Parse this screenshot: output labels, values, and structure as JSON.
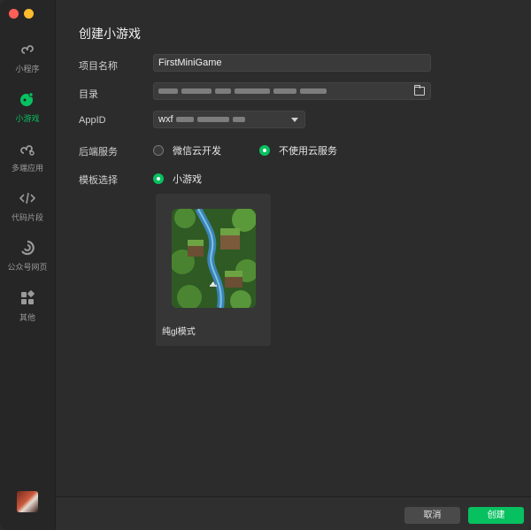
{
  "sidebar": {
    "items": [
      {
        "label": "小程序",
        "icon": "mini-program-icon"
      },
      {
        "label": "小游戏",
        "icon": "mini-game-icon",
        "active": true
      },
      {
        "label": "多端应用",
        "icon": "multi-platform-icon"
      },
      {
        "label": "代码片段",
        "icon": "code-snippet-icon"
      },
      {
        "label": "公众号网页",
        "icon": "official-account-icon"
      },
      {
        "label": "其他",
        "icon": "grid-icon"
      }
    ]
  },
  "main": {
    "title": "创建小游戏",
    "project_name": {
      "label": "项目名称",
      "value": "FirstMiniGame"
    },
    "directory": {
      "label": "目录"
    },
    "appid": {
      "label": "AppID",
      "value_prefix": "wxf"
    },
    "backend": {
      "label": "后端服务",
      "options": [
        {
          "label": "微信云开发",
          "checked": false
        },
        {
          "label": "不使用云服务",
          "checked": true
        }
      ]
    },
    "template": {
      "label": "模板选择",
      "options": [
        {
          "label": "小游戏",
          "checked": true
        }
      ],
      "cards": [
        {
          "name": "纯gl模式"
        }
      ]
    }
  },
  "footer": {
    "cancel_label": "取消",
    "create_label": "创建"
  },
  "colors": {
    "accent": "#07c160",
    "background": "#2c2c2c"
  }
}
